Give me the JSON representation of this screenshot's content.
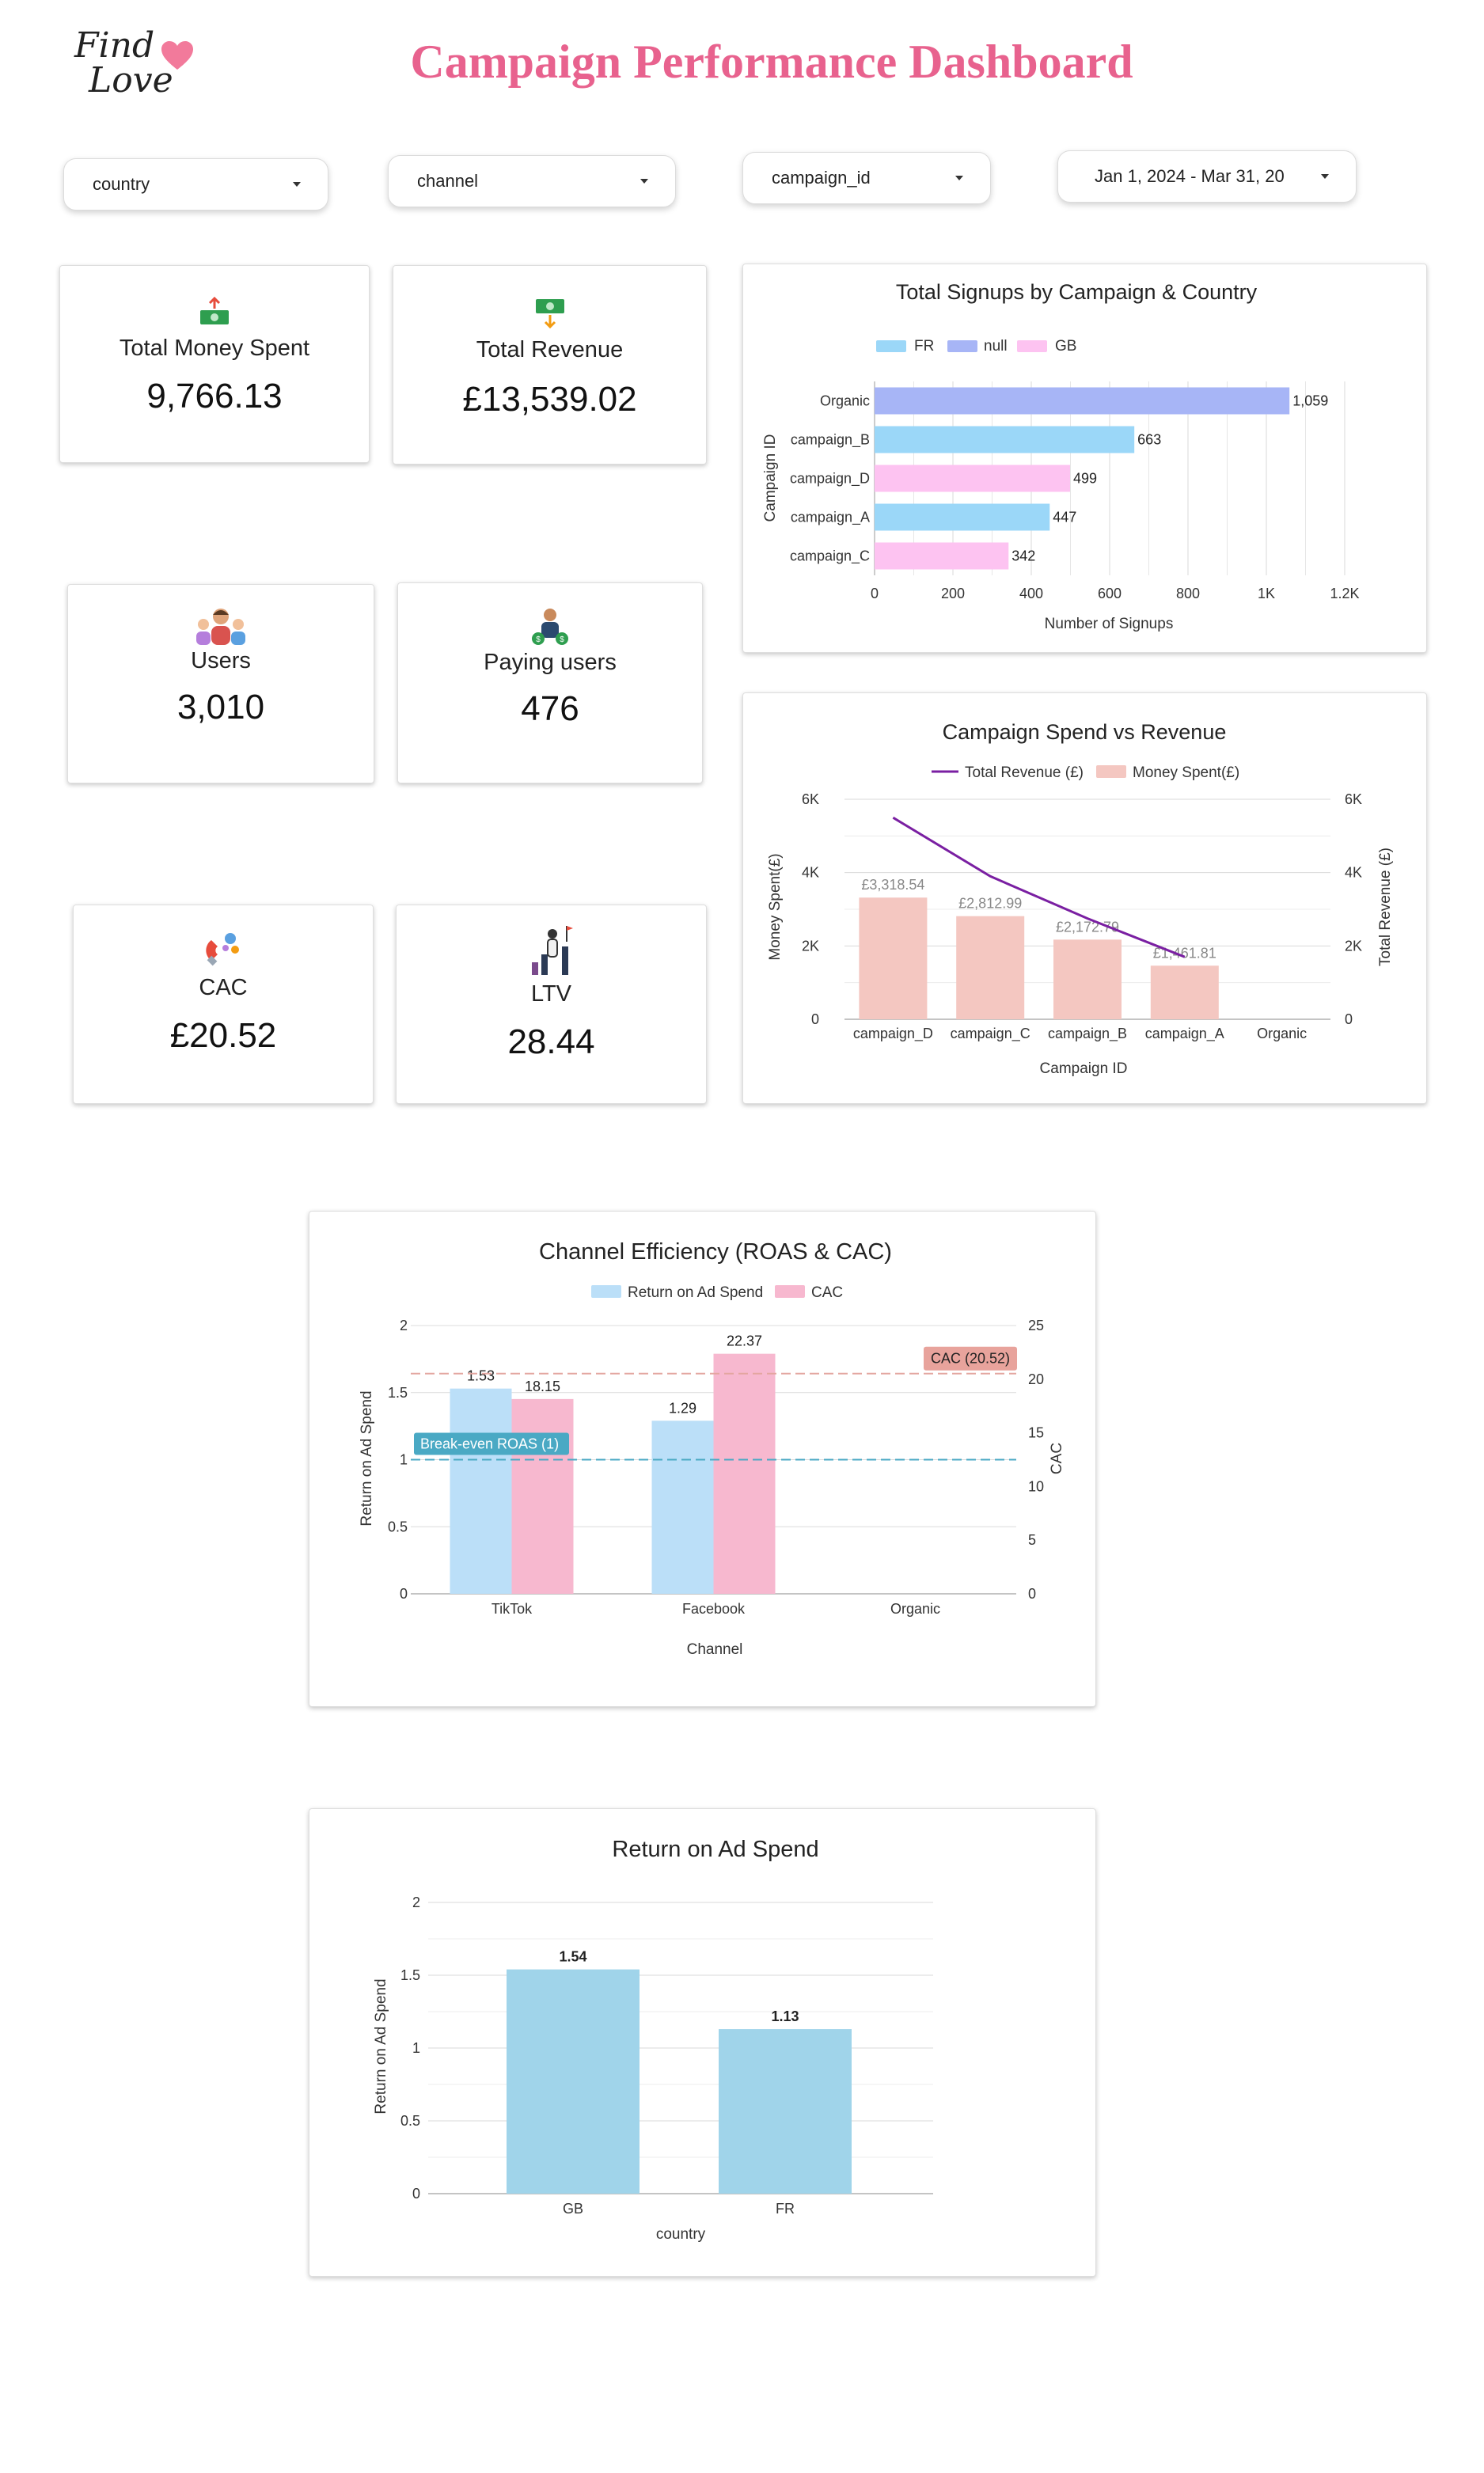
{
  "header": {
    "logo_line1": "Find",
    "logo_line2": "Love",
    "title": "Campaign Performance Dashboard"
  },
  "filters": {
    "country": "country",
    "channel": "channel",
    "campaign": "campaign_id",
    "date_range": "Jan 1, 2024 - Mar 31, 20"
  },
  "kpis": {
    "money_spent": {
      "label": "Total Money Spent",
      "value": "9,766.13",
      "icon": "money-out-icon"
    },
    "revenue": {
      "label": "Total Revenue",
      "value": "£13,539.02",
      "icon": "money-in-icon"
    },
    "users": {
      "label": "Users",
      "value": "3,010",
      "icon": "users-icon"
    },
    "paying_users": {
      "label": "Paying users",
      "value": "476",
      "icon": "paying-user-icon"
    },
    "cac": {
      "label": "CAC",
      "value": "£20.52",
      "icon": "magnet-icon"
    },
    "ltv": {
      "label": "LTV",
      "value": "28.44",
      "icon": "growth-icon"
    }
  },
  "colors": {
    "brand_pink": "#e8628e",
    "fr_blue": "#9bd7f8",
    "null_blue": "#a7b5f6",
    "gb_pink": "#fdc3f1",
    "spend_bar": "#f4c7c1",
    "revenue_line": "#7a1fa2",
    "roas_bar": "#bbdff8",
    "cac_bar": "#f7b8cf",
    "country_roas_bar": "#a0d4ea"
  },
  "chart_data": [
    {
      "type": "bar",
      "orientation": "horizontal",
      "title": "Total Signups by Campaign & Country",
      "xlabel": "Number of Signups",
      "ylabel": "Campaign ID",
      "legend": [
        "FR",
        "null",
        "GB"
      ],
      "legend_position": "top",
      "categories": [
        "Organic",
        "campaign_B",
        "campaign_D",
        "campaign_A",
        "campaign_C"
      ],
      "values": [
        1059,
        663,
        499,
        447,
        342
      ],
      "value_labels": [
        "1,059",
        "663",
        "499",
        "447",
        "342"
      ],
      "country": [
        "null",
        "FR",
        "GB",
        "FR",
        "GB"
      ],
      "xlim": [
        0,
        1200
      ],
      "x_ticks": [
        "0",
        "200",
        "400",
        "600",
        "800",
        "1K",
        "1.2K"
      ],
      "grid": true
    },
    {
      "type": "bar",
      "title": "Campaign Spend vs Revenue",
      "xlabel": "Campaign ID",
      "ylabel": "Money Spent(£)",
      "y2label": "Total Revenue (£)",
      "legend_position": "top",
      "categories": [
        "campaign_D",
        "campaign_C",
        "campaign_B",
        "campaign_A",
        "Organic"
      ],
      "series": [
        {
          "name": "Money Spent(£)",
          "type": "bar",
          "values": [
            3318.54,
            2812.99,
            2172.79,
            1461.81,
            null
          ],
          "labels": [
            "£3,318.54",
            "£2,812.99",
            "£2,172.79",
            "£1,461.81",
            ""
          ]
        },
        {
          "name": "Total Revenue (£)",
          "type": "line",
          "axis": "right",
          "values": [
            5500,
            3900,
            2750,
            1700,
            null
          ]
        }
      ],
      "ylim": [
        0,
        6000
      ],
      "y_ticks": [
        "0",
        "2K",
        "4K",
        "6K"
      ],
      "grid": true
    },
    {
      "type": "bar",
      "title": "Channel Efficiency (ROAS & CAC)",
      "xlabel": "Channel",
      "ylabel": "Return on Ad Spend",
      "y2label": "CAC",
      "legend_position": "top",
      "categories": [
        "TikTok",
        "Facebook",
        "Organic"
      ],
      "series": [
        {
          "name": "Return on Ad Spend",
          "axis": "left",
          "values": [
            1.53,
            1.29,
            null
          ]
        },
        {
          "name": "CAC",
          "axis": "right",
          "values": [
            18.15,
            22.37,
            null
          ]
        }
      ],
      "ylim": [
        0,
        2
      ],
      "y2lim": [
        0,
        25
      ],
      "y_ticks": [
        "0",
        "0.5",
        "1",
        "1.5",
        "2"
      ],
      "y2_ticks": [
        "0",
        "5",
        "10",
        "15",
        "20",
        "25"
      ],
      "reference_lines": [
        {
          "label": "Break-even ROAS (1)",
          "axis": "left",
          "value": 1
        },
        {
          "label": "CAC (20.52)",
          "axis": "right",
          "value": 20.52
        }
      ],
      "grid": true
    },
    {
      "type": "bar",
      "title": "Return on Ad Spend",
      "xlabel": "country",
      "ylabel": "Return on Ad Spend",
      "categories": [
        "GB",
        "FR"
      ],
      "values": [
        1.54,
        1.13
      ],
      "ylim": [
        0,
        2
      ],
      "y_ticks": [
        "0",
        "0.5",
        "1",
        "1.5",
        "2"
      ],
      "grid": true
    }
  ]
}
